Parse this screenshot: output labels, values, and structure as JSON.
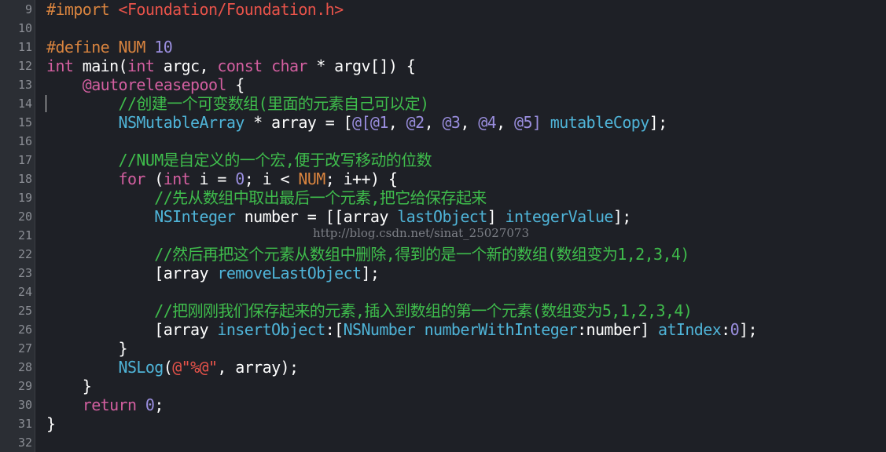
{
  "colors": {
    "background": "#1e2026",
    "gutter": "#2b2e34",
    "line_number": "#8b8e95",
    "plain": "#ffffff",
    "keyword": "#d35fa0",
    "preprocessor": "#d9843f",
    "string": "#e8534a",
    "number": "#9b8fe0",
    "comment": "#3fbd4c",
    "type": "#4fb4d8",
    "method": "#4fb4d8",
    "macro": "#d9843f"
  },
  "watermark": "http://blog.csdn.net/sinat_25027073",
  "lines": [
    {
      "n": "9",
      "tokens": [
        {
          "t": "#import ",
          "c": "preprocessor"
        },
        {
          "t": "<Foundation/Foundation.h>",
          "c": "string"
        }
      ]
    },
    {
      "n": "10",
      "tokens": []
    },
    {
      "n": "11",
      "tokens": [
        {
          "t": "#define ",
          "c": "preprocessor"
        },
        {
          "t": "NUM ",
          "c": "preprocessor"
        },
        {
          "t": "10",
          "c": "number"
        }
      ]
    },
    {
      "n": "12",
      "tokens": [
        {
          "t": "int",
          "c": "keyword"
        },
        {
          "t": " main(",
          "c": "plain"
        },
        {
          "t": "int",
          "c": "keyword"
        },
        {
          "t": " argc, ",
          "c": "plain"
        },
        {
          "t": "const",
          "c": "keyword"
        },
        {
          "t": " ",
          "c": "plain"
        },
        {
          "t": "char",
          "c": "keyword"
        },
        {
          "t": " * argv[]) {",
          "c": "plain"
        }
      ]
    },
    {
      "n": "13",
      "tokens": [
        {
          "t": "    ",
          "c": "plain"
        },
        {
          "t": "@autoreleasepool",
          "c": "keyword"
        },
        {
          "t": " {",
          "c": "plain"
        }
      ]
    },
    {
      "n": "14",
      "tokens": [
        {
          "t": "        ",
          "c": "plain"
        },
        {
          "t": "//创建一个可变数组(里面的元素自己可以定)",
          "c": "comment"
        }
      ]
    },
    {
      "n": "15",
      "tokens": [
        {
          "t": "        ",
          "c": "plain"
        },
        {
          "t": "NSMutableArray",
          "c": "type"
        },
        {
          "t": " * array = [",
          "c": "plain"
        },
        {
          "t": "@[@1",
          "c": "number"
        },
        {
          "t": ", ",
          "c": "plain"
        },
        {
          "t": "@2",
          "c": "number"
        },
        {
          "t": ", ",
          "c": "plain"
        },
        {
          "t": "@3",
          "c": "number"
        },
        {
          "t": ", ",
          "c": "plain"
        },
        {
          "t": "@4",
          "c": "number"
        },
        {
          "t": ", ",
          "c": "plain"
        },
        {
          "t": "@5]",
          "c": "number"
        },
        {
          "t": " ",
          "c": "plain"
        },
        {
          "t": "mutableCopy",
          "c": "method"
        },
        {
          "t": "];",
          "c": "plain"
        }
      ]
    },
    {
      "n": "16",
      "tokens": []
    },
    {
      "n": "17",
      "tokens": [
        {
          "t": "        ",
          "c": "plain"
        },
        {
          "t": "//NUM是自定义的一个宏,便于改写移动的位数",
          "c": "comment"
        }
      ]
    },
    {
      "n": "18",
      "tokens": [
        {
          "t": "        ",
          "c": "plain"
        },
        {
          "t": "for",
          "c": "keyword"
        },
        {
          "t": " (",
          "c": "plain"
        },
        {
          "t": "int",
          "c": "keyword"
        },
        {
          "t": " i = ",
          "c": "plain"
        },
        {
          "t": "0",
          "c": "number"
        },
        {
          "t": "; i < ",
          "c": "plain"
        },
        {
          "t": "NUM",
          "c": "macro"
        },
        {
          "t": "; i++) {",
          "c": "plain"
        }
      ]
    },
    {
      "n": "19",
      "tokens": [
        {
          "t": "            ",
          "c": "plain"
        },
        {
          "t": "//先从数组中取出最后一个元素,把它给保存起来",
          "c": "comment"
        }
      ]
    },
    {
      "n": "20",
      "tokens": [
        {
          "t": "            ",
          "c": "plain"
        },
        {
          "t": "NSInteger",
          "c": "type"
        },
        {
          "t": " number = [[array ",
          "c": "plain"
        },
        {
          "t": "lastObject",
          "c": "method"
        },
        {
          "t": "] ",
          "c": "plain"
        },
        {
          "t": "integerValue",
          "c": "method"
        },
        {
          "t": "];",
          "c": "plain"
        }
      ]
    },
    {
      "n": "21",
      "tokens": []
    },
    {
      "n": "22",
      "tokens": [
        {
          "t": "            ",
          "c": "plain"
        },
        {
          "t": "//然后再把这个元素从数组中删除,得到的是一个新的数组(数组变为1,2,3,4)",
          "c": "comment"
        }
      ]
    },
    {
      "n": "23",
      "tokens": [
        {
          "t": "            [array ",
          "c": "plain"
        },
        {
          "t": "removeLastObject",
          "c": "method"
        },
        {
          "t": "];",
          "c": "plain"
        }
      ]
    },
    {
      "n": "24",
      "tokens": []
    },
    {
      "n": "25",
      "tokens": [
        {
          "t": "            ",
          "c": "plain"
        },
        {
          "t": "//把刚刚我们保存起来的元素,插入到数组的第一个元素(数组变为5,1,2,3,4)",
          "c": "comment"
        }
      ]
    },
    {
      "n": "26",
      "tokens": [
        {
          "t": "            [array ",
          "c": "plain"
        },
        {
          "t": "insertObject",
          "c": "method"
        },
        {
          "t": ":[",
          "c": "plain"
        },
        {
          "t": "NSNumber",
          "c": "type"
        },
        {
          "t": " ",
          "c": "plain"
        },
        {
          "t": "numberWithInteger",
          "c": "method"
        },
        {
          "t": ":number] ",
          "c": "plain"
        },
        {
          "t": "atIndex",
          "c": "method"
        },
        {
          "t": ":",
          "c": "plain"
        },
        {
          "t": "0",
          "c": "number"
        },
        {
          "t": "];",
          "c": "plain"
        }
      ]
    },
    {
      "n": "27",
      "tokens": [
        {
          "t": "        }",
          "c": "plain"
        }
      ]
    },
    {
      "n": "28",
      "tokens": [
        {
          "t": "        ",
          "c": "plain"
        },
        {
          "t": "NSLog",
          "c": "method"
        },
        {
          "t": "(",
          "c": "plain"
        },
        {
          "t": "@\"%@\"",
          "c": "string"
        },
        {
          "t": ", array);",
          "c": "plain"
        }
      ]
    },
    {
      "n": "29",
      "tokens": [
        {
          "t": "    }",
          "c": "plain"
        }
      ]
    },
    {
      "n": "30",
      "tokens": [
        {
          "t": "    ",
          "c": "plain"
        },
        {
          "t": "return",
          "c": "keyword"
        },
        {
          "t": " ",
          "c": "plain"
        },
        {
          "t": "0",
          "c": "number"
        },
        {
          "t": ";",
          "c": "plain"
        }
      ]
    },
    {
      "n": "31",
      "tokens": [
        {
          "t": "}",
          "c": "plain"
        }
      ]
    },
    {
      "n": "32",
      "tokens": []
    }
  ]
}
